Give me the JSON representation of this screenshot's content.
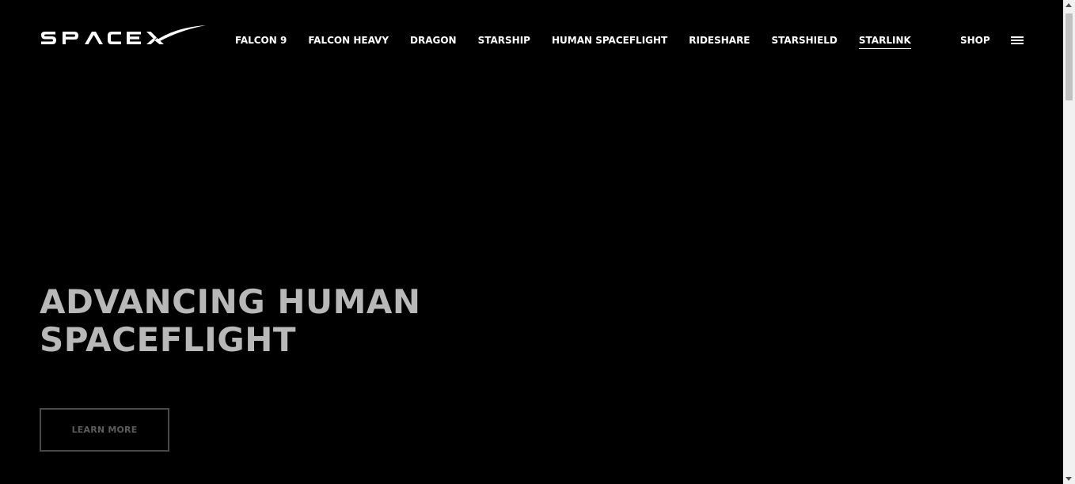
{
  "header": {
    "logo": {
      "text": "SPACEX",
      "icon": "spacex-logo"
    },
    "nav": [
      {
        "label": "FALCON 9",
        "active": false
      },
      {
        "label": "FALCON HEAVY",
        "active": false
      },
      {
        "label": "DRAGON",
        "active": false
      },
      {
        "label": "STARSHIP",
        "active": false
      },
      {
        "label": "HUMAN SPACEFLIGHT",
        "active": false
      },
      {
        "label": "RIDESHARE",
        "active": false
      },
      {
        "label": "STARSHIELD",
        "active": false
      },
      {
        "label": "STARLINK",
        "active": true
      }
    ],
    "shop_label": "SHOP",
    "menu_icon": "hamburger-menu-icon"
  },
  "hero": {
    "title_line1": "ADVANCING HUMAN",
    "title_line2": "SPACEFLIGHT",
    "button_label": "LEARN MORE"
  },
  "colors": {
    "background": "#000000",
    "nav_text": "#ffffff",
    "hero_title": "#b8b8b8",
    "button_border": "#4a4a4a",
    "button_text": "#5c5c5c"
  }
}
